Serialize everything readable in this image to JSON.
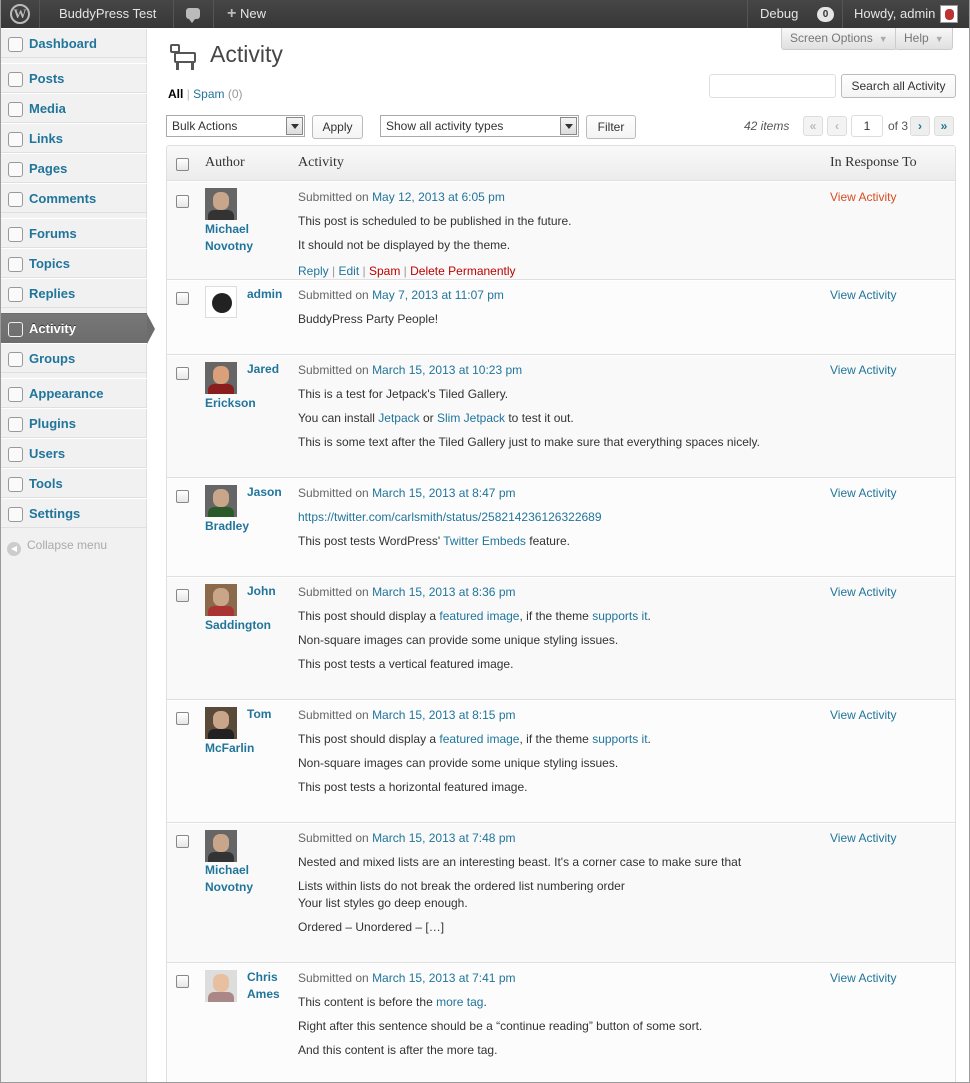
{
  "adminbar": {
    "site_name": "BuddyPress Test",
    "new_label": "New",
    "debug_label": "Debug",
    "debug_count": "0",
    "howdy": "Howdy, admin"
  },
  "sidebar": {
    "items": [
      {
        "label": "Dashboard",
        "icon": "dashboard-icon"
      },
      {
        "label": "Posts",
        "icon": "pin-icon"
      },
      {
        "label": "Media",
        "icon": "media-icon"
      },
      {
        "label": "Links",
        "icon": "link-icon"
      },
      {
        "label": "Pages",
        "icon": "pages-icon"
      },
      {
        "label": "Comments",
        "icon": "comment-icon"
      },
      {
        "label": "Forums",
        "icon": "forums-icon"
      },
      {
        "label": "Topics",
        "icon": "topics-icon"
      },
      {
        "label": "Replies",
        "icon": "replies-icon"
      },
      {
        "label": "Activity",
        "icon": "activity-icon"
      },
      {
        "label": "Groups",
        "icon": "groups-icon"
      },
      {
        "label": "Appearance",
        "icon": "appearance-icon"
      },
      {
        "label": "Plugins",
        "icon": "plugins-icon"
      },
      {
        "label": "Users",
        "icon": "users-icon"
      },
      {
        "label": "Tools",
        "icon": "tools-icon"
      },
      {
        "label": "Settings",
        "icon": "settings-icon"
      }
    ],
    "collapse_label": "Collapse menu"
  },
  "header": {
    "screen_options": "Screen Options",
    "help": "Help",
    "title": "Activity"
  },
  "filters": {
    "all_label": "All",
    "spam_label": "Spam",
    "spam_count": "(0)"
  },
  "search": {
    "value": "",
    "button": "Search all Activity"
  },
  "toolbar": {
    "bulk_actions": "Bulk Actions",
    "apply": "Apply",
    "type_filter": "Show all activity types",
    "filter": "Filter",
    "items_count": "42 items",
    "page_current": "1",
    "page_of": "of 3",
    "first": "«",
    "prev": "‹",
    "next": "›",
    "last": "»"
  },
  "table": {
    "columns": [
      "Author",
      "Activity",
      "In Response To"
    ],
    "rows": [
      {
        "author_first": "Michael",
        "author_last": "Novotny",
        "submitted": "Submitted on",
        "date": "May 12, 2013 at 6:05 pm",
        "lines": [
          "This post is scheduled to be published in the future.",
          "It should not be displayed by the theme."
        ],
        "actions": {
          "reply": "Reply",
          "edit": "Edit",
          "spam": "Spam",
          "delete": "Delete Permanently"
        },
        "response": "View Activity"
      },
      {
        "author_first": "admin",
        "author_last": "",
        "submitted": "Submitted on",
        "date": "May 7, 2013 at 11:07 pm",
        "lines": [
          "BuddyPress Party People!"
        ],
        "response": "View Activity"
      },
      {
        "author_first": "Jared",
        "author_last": "Erickson",
        "submitted": "Submitted on",
        "date": "March 15, 2013 at 10:23 pm",
        "lines": [
          "This is a test for Jetpack's Tiled Gallery."
        ],
        "line2": {
          "a": "You can install ",
          "b": "Jetpack",
          "c": " or ",
          "d": "Slim Jetpack",
          "e": " to test it out."
        },
        "line3": "This is some text after the Tiled Gallery just to make sure that everything spaces nicely.",
        "response": "View Activity"
      },
      {
        "author_first": "Jason",
        "author_last": "Bradley",
        "submitted": "Submitted on",
        "date": "March 15, 2013 at 8:47 pm",
        "link": "https://twitter.com/carlsmith/status/258214236126322689",
        "line2": {
          "a": "This post tests WordPress' ",
          "b": "Twitter Embeds",
          "c": " feature."
        },
        "response": "View Activity"
      },
      {
        "author_first": "John",
        "author_last": "Saddington",
        "submitted": "Submitted on",
        "date": "March 15, 2013 at 8:36 pm",
        "line1": {
          "a": "This post should display a ",
          "b": "featured image",
          "c": ", if the theme ",
          "d": "supports it",
          "e": "."
        },
        "line2": "Non-square images can provide some unique styling issues.",
        "line3": "This post tests a vertical featured image.",
        "response": "View Activity"
      },
      {
        "author_first": "Tom",
        "author_last": "McFarlin",
        "submitted": "Submitted on",
        "date": "March 15, 2013 at 8:15 pm",
        "line1": {
          "a": "This post should display a ",
          "b": "featured image",
          "c": ", if the theme ",
          "d": "supports it",
          "e": "."
        },
        "line2": "Non-square images can provide some unique styling issues.",
        "line3": "This post tests a horizontal featured image.",
        "response": "View Activity"
      },
      {
        "author_first": "Michael",
        "author_last": "Novotny",
        "submitted": "Submitted on",
        "date": "March 15, 2013 at 7:48 pm",
        "lines": [
          "Nested and mixed lists are an interesting beast. It's a corner case to make sure that",
          "Lists within lists do not break the ordered list numbering order",
          "Your list styles go deep enough.",
          "Ordered – Unordered – […]"
        ],
        "response": "View Activity"
      },
      {
        "author_first": "Chris",
        "author_last": "Ames",
        "submitted": "Submitted on",
        "date": "March 15, 2013 at 7:41 pm",
        "line1": {
          "a": "This content is before the ",
          "b": "more tag",
          "c": "."
        },
        "line2": "Right after this sentence should be a “continue reading” button of some sort.",
        "line3": "And this content is after the more tag.",
        "response": "View Activity"
      }
    ]
  }
}
